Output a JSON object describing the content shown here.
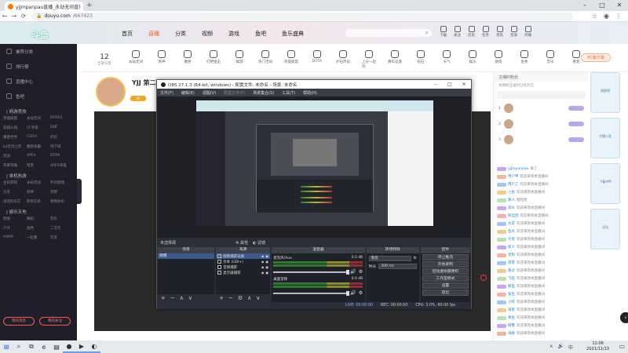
{
  "browser": {
    "tab_title": "yjjmpanpau直播_永劫无间直播",
    "new_tab": "+",
    "win_min": "–",
    "win_max": "□",
    "win_close": "✕",
    "url_host": "douyu.com",
    "url_path": "/667423",
    "back": "←",
    "forward": "→",
    "reload": "⟳",
    "lock": "🔒",
    "star": "☆",
    "profile": "◉",
    "menu": "⋮"
  },
  "site": {
    "logo": "斗鱼",
    "nav": [
      "首页",
      "直播",
      "分类",
      "视频",
      "游戏",
      "鱼吧",
      "鱼乐盛典"
    ],
    "active_nav": 1,
    "search_icon": "⌕",
    "header_icons": [
      "下载",
      "关注",
      "历史",
      "任务",
      "消息",
      "充值",
      "开播"
    ]
  },
  "sidebar": {
    "items": [
      "推荐分类",
      "排行榜",
      "直播中心",
      "鱼吧"
    ],
    "sections": [
      {
        "title": "| 网游竞技",
        "games": [
          "英雄联盟",
          "永劫无间",
          "DOTA2",
          "穿越火线",
          "CF手游",
          "DNF",
          "魔兽世界",
          "CSGO",
          "炉石",
          "lol云顶之弈",
          "魔兽争霸",
          "地下城",
          "逆战",
          "APEX",
          "DOTA",
          "风暴英雄",
          "暗黑",
          "APEX英雄"
        ]
      },
      {
        "title": "| 单机热游",
        "games": [
          "主机游戏",
          "永劫无间",
          "怀旧游戏",
          "方舟",
          "原神",
          "荒野",
          "消逝的光芒",
          "刺客信条",
          "黎明杀机"
        ]
      },
      {
        "title": "| 娱乐天地",
        "games": [
          "颜值",
          "舞蹈",
          "音乐",
          "户外",
          "星秀",
          "二次元",
          "ASMR",
          "一起看",
          "交友"
        ]
      }
    ],
    "btn_left": "我的消息",
    "btn_right": "我的关注"
  },
  "categories": {
    "count": "12",
    "count_label": "全部分类",
    "items": [
      "永劫无间",
      "原神",
      "魔兽",
      "打野狙击",
      "端游",
      "热门活动",
      "英雄联盟",
      "DOTA",
      "炉石传说",
      "上分一起玩",
      "赛车竞速",
      "钻石",
      "天气",
      "娱乐",
      "颜值",
      "星秀",
      "音乐",
      "看客"
    ],
    "pc_button": "PC客户端"
  },
  "streamer": {
    "name": "YJJ 第二季",
    "level": "LV"
  },
  "chat": {
    "header": "主播的粉丝",
    "sub": "本期粉丝福利已经开启",
    "ranks": [
      "1",
      "2",
      "3"
    ],
    "messages": [
      {
        "user": "yjjmpanpau",
        "text": "来了",
        "color": "#c7a6f5"
      },
      {
        "user": "用户甲",
        "text": "欢迎来到本直播间",
        "color": "#f6b3a3"
      },
      {
        "user": "用户乙",
        "text": "欢迎来到本直播间",
        "color": "#a4c6f2"
      },
      {
        "user": "小鱼",
        "text": "欢迎来到本直播间",
        "color": "#f3c98c"
      },
      {
        "user": "路人",
        "text": "哈哈哈",
        "color": "#b7e1b0"
      },
      {
        "user": "观众",
        "text": "欢迎来到本直播间",
        "color": "#c7a6f5"
      },
      {
        "user": "粉丝团",
        "text": "欢迎来到本直播间",
        "color": "#f6b3a3"
      },
      {
        "user": "水友",
        "text": "欢迎来到本直播间",
        "color": "#a4c6f2"
      },
      {
        "user": "鱼丸",
        "text": "欢迎来到本直播间",
        "color": "#f3c98c"
      },
      {
        "user": "大佬",
        "text": "欢迎来到本直播间",
        "color": "#b7e1b0"
      },
      {
        "user": "新人",
        "text": "欢迎来到本直播间",
        "color": "#c7a6f5"
      },
      {
        "user": "老粉",
        "text": "欢迎来到本直播间",
        "color": "#f6b3a3"
      },
      {
        "user": "游客",
        "text": "欢迎来到本直播间",
        "color": "#a4c6f2"
      },
      {
        "user": "路过",
        "text": "欢迎来到本直播间",
        "color": "#f3c98c"
      },
      {
        "user": "飞鱼",
        "text": "欢迎来到本直播间",
        "color": "#b7e1b0"
      },
      {
        "user": "鲸鱼",
        "text": "欢迎来到本直播间",
        "color": "#c7a6f5"
      },
      {
        "user": "鲨鱼",
        "text": "欢迎来到本直播间",
        "color": "#f6b3a3"
      },
      {
        "user": "小虾",
        "text": "欢迎来到本直播间",
        "color": "#a4c6f2"
      },
      {
        "user": "海星",
        "text": "欢迎来到本直播间",
        "color": "#f3c98c"
      },
      {
        "user": "章鱼",
        "text": "欢迎来到本直播间",
        "color": "#b7e1b0"
      },
      {
        "user": "螃蟹",
        "text": "欢迎来到本直播间",
        "color": "#c7a6f5"
      },
      {
        "user": "海豚",
        "text": "欢迎来到本直播间",
        "color": "#f6b3a3"
      }
    ]
  },
  "right_ads": [
    "周星榜",
    "主播入驻",
    "下载APP",
    "活动"
  ],
  "obs": {
    "title": "OBS 27.1.3 (64-bit, windows) - 配置文件: 未命名 - 场景: 未命名",
    "menu": [
      "文件(F)",
      "编辑(E)",
      "视图(V)",
      "配置文件(P)",
      "场景集合(S)",
      "工具(T)",
      "帮助(H)"
    ],
    "source_bar": "未选择源",
    "props": "属性",
    "filters": "滤镜",
    "docks": {
      "scenes": "场景",
      "sources": "来源",
      "mixer": "混音器",
      "transitions": "转场特效",
      "controls": "控件"
    },
    "scene_items": [
      "场景"
    ],
    "sources": [
      "视频捕获设备",
      "文本 (GDI+)",
      "音频捕获",
      "显示器捕获"
    ],
    "mixer": [
      {
        "name": "麦克风/Aux",
        "db": "0.0 dB"
      },
      {
        "name": "桌面音频",
        "db": "0.0 dB"
      }
    ],
    "transition": {
      "label": "渐变",
      "duration_label": "时长",
      "duration": "300 ms"
    },
    "controls": [
      "停止推流",
      "开始录制",
      "启动虚拟摄像机",
      "工作室模式",
      "设置",
      "退出"
    ],
    "status": {
      "live": "LIVE: 00:00:00",
      "rec": "REC: 00:00:00",
      "cpu": "CPU: 3.0%, 60.00 fps"
    }
  },
  "taskbar": {
    "start": "⊞",
    "icons": [
      "⌕",
      "⧉",
      "e",
      "▤",
      "●",
      "▶",
      "◐"
    ],
    "time": "11:06",
    "date": "2021/11/13",
    "tray": [
      "∧",
      "🔊",
      "中"
    ],
    "notify": "▭"
  },
  "colors": {
    "accent": "#ff5d23",
    "obs_bg": "#2b2e38",
    "sidebar_bg": "#1f1f2b"
  }
}
